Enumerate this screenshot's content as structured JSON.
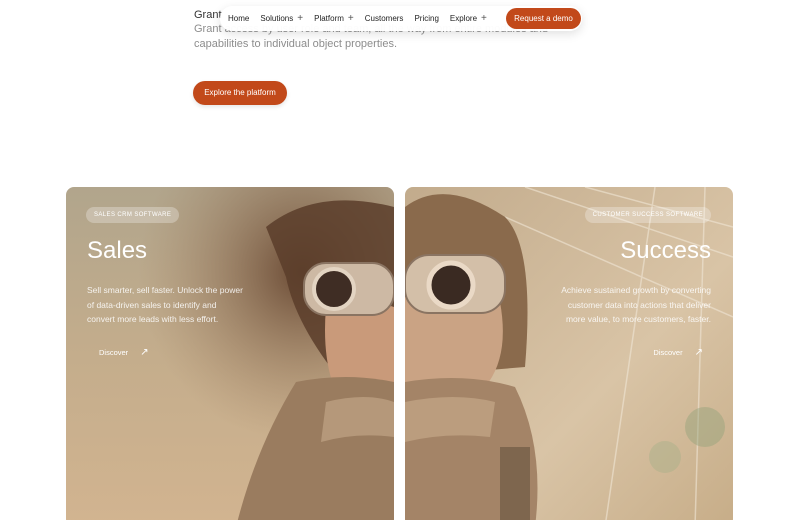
{
  "hero": {
    "title_partial": "Grant",
    "subtitle_lines": [
      "Grant access by user role and team, all the way from entire modules and",
      "capabilities to individual object properties."
    ],
    "cta_label": "Explore the platform"
  },
  "nav": {
    "items": [
      {
        "label": "Home",
        "icon": ""
      },
      {
        "label": "Solutions",
        "icon": "plus-icon"
      },
      {
        "label": "Platform",
        "icon": "plus-icon"
      },
      {
        "label": "Customers",
        "icon": ""
      },
      {
        "label": "Pricing",
        "icon": ""
      },
      {
        "label": "Explore",
        "icon": "plus-icon"
      }
    ],
    "demo_label": "Request a demo",
    "plus_glyph": "+"
  },
  "cards": [
    {
      "pill": "SALES CRM SOFTWARE",
      "title": "Sales",
      "desc_lines": [
        "Sell smarter, sell faster. Unlock the power",
        "of data-driven sales to identify and",
        "convert more leads with less effort."
      ],
      "link": "Discover",
      "link_icon": "arrow-up-right-icon"
    },
    {
      "pill": "CUSTOMER SUCCESS SOFTWARE",
      "title": "Success",
      "desc_lines": [
        "Achieve sustained growth by converting",
        "customer data into actions that deliver",
        "more value, to more customers, faster."
      ],
      "link": "Discover",
      "link_icon": "arrow-up-right-icon"
    }
  ],
  "colors": {
    "accent": "#c2491a",
    "card_bg_warm": "#b89a78",
    "card_bg_light": "#d8c6ac"
  },
  "arrow_glyph": "↗"
}
